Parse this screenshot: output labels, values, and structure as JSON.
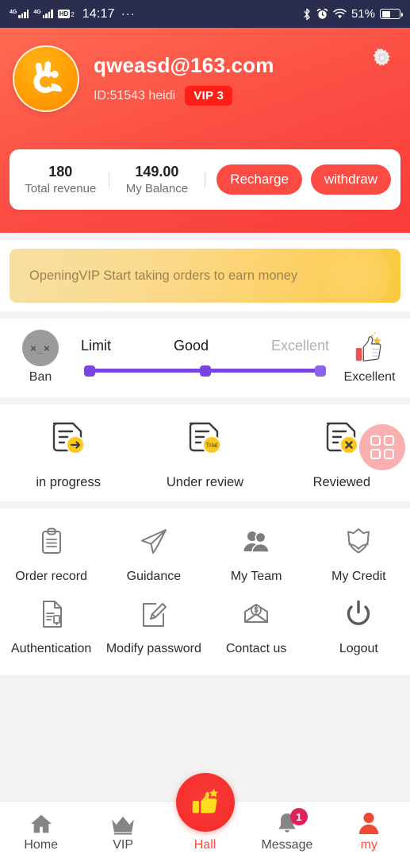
{
  "status_bar": {
    "network_1": "4G",
    "network_2": "4G",
    "hd_label": "HD",
    "hd_sub": "2",
    "time": "14:17",
    "overflow": "···",
    "battery_percent": "51%"
  },
  "header": {
    "username": "qweasd@163.com",
    "user_id": "ID:51543 heidi",
    "vip_badge": "VIP 3",
    "accent_color": "#fb4c43"
  },
  "balance_card": {
    "total_revenue_value": "180",
    "total_revenue_label": "Total revenue",
    "balance_value": "149.00",
    "balance_label": "My Balance",
    "recharge_label": "Recharge",
    "withdraw_label": "withdraw"
  },
  "vip_banner": {
    "text": "OpeningVIP Start taking orders to earn money"
  },
  "credit": {
    "ban_face": "×_×",
    "ban_label": "Ban",
    "tick_low": "Limit",
    "tick_mid": "Good",
    "tick_high": "Excellent",
    "excellent_label": "Excellent",
    "slider_color": "#7a44e0"
  },
  "orders": [
    {
      "label": "in progress",
      "icon": "doc-arrow-icon"
    },
    {
      "label": "Under review",
      "icon": "doc-trial-icon",
      "badge_text": "Trial"
    },
    {
      "label": "Reviewed",
      "icon": "doc-x-icon"
    }
  ],
  "floating_grid_button": {
    "name": "grid-menu-button"
  },
  "menu": {
    "row1": [
      {
        "label": "Order record",
        "icon": "clipboard-icon"
      },
      {
        "label": "Guidance",
        "icon": "paper-plane-icon"
      },
      {
        "label": "My Team",
        "icon": "users-icon"
      },
      {
        "label": "My Credit",
        "icon": "shield-icon"
      }
    ],
    "row2": [
      {
        "label": "Authentication",
        "icon": "document-id-icon"
      },
      {
        "label": "Modify password",
        "icon": "pencil-square-icon"
      },
      {
        "label": "Contact us",
        "icon": "envelope-dollar-icon"
      },
      {
        "label": "Logout",
        "icon": "power-icon"
      }
    ]
  },
  "tabbar": [
    {
      "label": "Home",
      "icon": "home-icon",
      "active": false
    },
    {
      "label": "VIP",
      "icon": "crown-icon",
      "active": false
    },
    {
      "label": "Hall",
      "icon": "thumbs-up-star-icon",
      "active": true
    },
    {
      "label": "Message",
      "icon": "bell-icon",
      "active": false,
      "badge": "1"
    },
    {
      "label": "my",
      "icon": "person-icon",
      "active": true
    }
  ]
}
